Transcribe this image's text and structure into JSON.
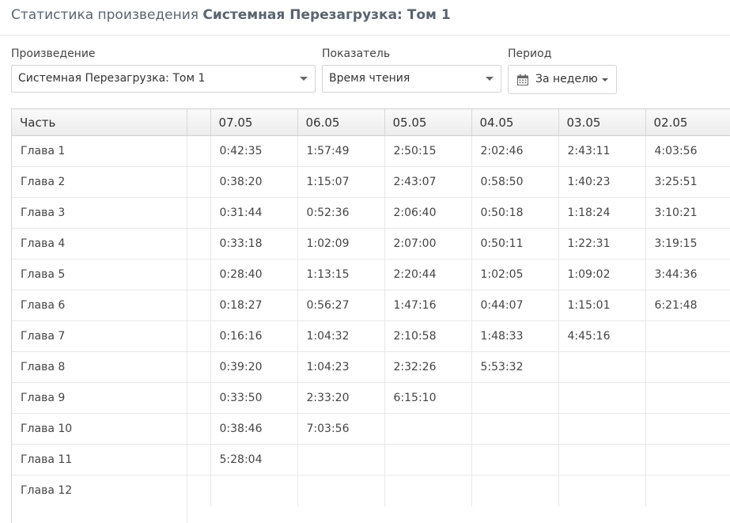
{
  "page": {
    "title_prefix": "Статистика произведения ",
    "title_work": "Системная Перезагрузка: Том 1"
  },
  "filters": {
    "work_label": "Произведение",
    "work_value": "Системная Перезагрузка: Том 1",
    "metric_label": "Показатель",
    "metric_value": "Время чтения",
    "period_label": "Период",
    "period_value": "За неделю"
  },
  "table": {
    "columns": [
      "Часть",
      "",
      "07.05",
      "06.05",
      "05.05",
      "04.05",
      "03.05",
      "02.05"
    ],
    "rows": [
      [
        "Глава 1",
        "",
        "0:42:35",
        "1:57:49",
        "2:50:15",
        "2:02:46",
        "2:43:11",
        "4:03:56"
      ],
      [
        "Глава 2",
        "",
        "0:38:20",
        "1:15:07",
        "2:43:07",
        "0:58:50",
        "1:40:23",
        "3:25:51"
      ],
      [
        "Глава 3",
        "",
        "0:31:44",
        "0:52:36",
        "2:06:40",
        "0:50:18",
        "1:18:24",
        "3:10:21"
      ],
      [
        "Глава 4",
        "",
        "0:33:18",
        "1:02:09",
        "2:07:00",
        "0:50:11",
        "1:22:31",
        "3:19:15"
      ],
      [
        "Глава 5",
        "",
        "0:28:40",
        "1:13:15",
        "2:20:44",
        "1:02:05",
        "1:09:02",
        "3:44:36"
      ],
      [
        "Глава 6",
        "",
        "0:18:27",
        "0:56:27",
        "1:47:16",
        "0:44:07",
        "1:15:01",
        "6:21:48"
      ],
      [
        "Глава 7",
        "",
        "0:16:16",
        "1:04:32",
        "2:10:58",
        "1:48:33",
        "4:45:16",
        ""
      ],
      [
        "Глава 8",
        "",
        "0:39:20",
        "1:04:23",
        "2:32:26",
        "5:53:32",
        "",
        ""
      ],
      [
        "Глава 9",
        "",
        "0:33:50",
        "2:33:20",
        "6:15:10",
        "",
        "",
        ""
      ],
      [
        "Глава 10",
        "",
        "0:38:46",
        "7:03:56",
        "",
        "",
        "",
        ""
      ],
      [
        "Глава 11",
        "",
        "5:28:04",
        "",
        "",
        "",
        "",
        ""
      ],
      [
        "Глава 12",
        "",
        "",
        "",
        "",
        "",
        "",
        ""
      ]
    ]
  }
}
